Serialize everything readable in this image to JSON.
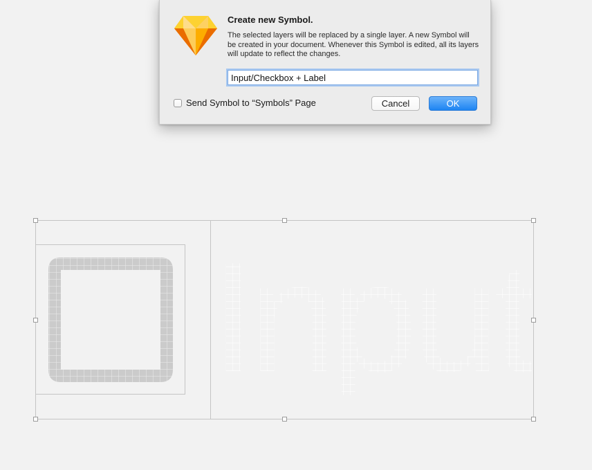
{
  "dialog": {
    "title": "Create new Symbol.",
    "message": "The selected layers will be replaced by a single layer. A new Symbol will be created in your document. Whenever this Symbol is edited, all its layers will update to reflect the changes.",
    "symbol_name_value": "Input/Checkbox + Label",
    "checkbox_label": "Send Symbol to “Symbols” Page",
    "checkbox_checked": false,
    "cancel_label": "Cancel",
    "ok_label": "OK",
    "app_icon": "sketch-diamond-icon"
  },
  "canvas": {
    "text_layer": "Input",
    "checkbox_layer": "checkbox-shape"
  },
  "colors": {
    "accent": "#1d84f2",
    "text_layer": "#2d2d2d",
    "checkbox_shape": "#cbcbcb",
    "canvas_bg": "#f2f2f2"
  }
}
